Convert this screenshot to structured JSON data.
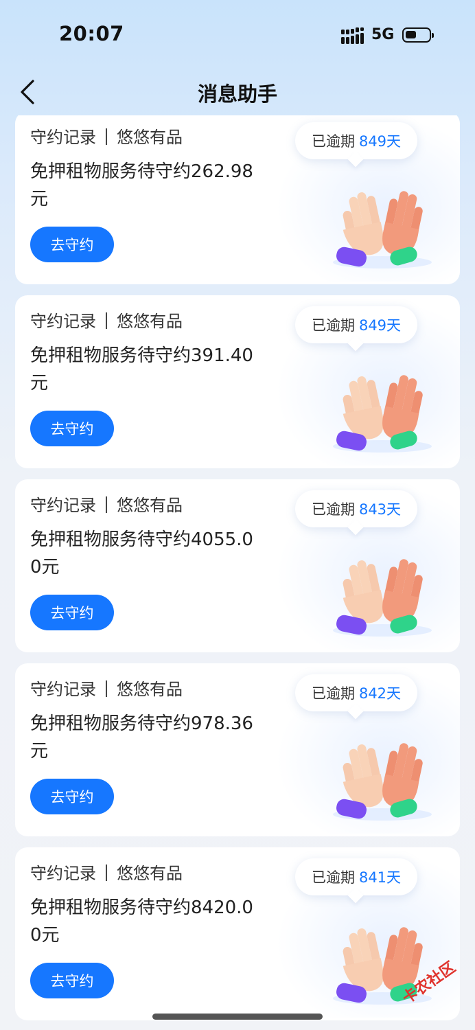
{
  "status_bar": {
    "time": "20:07",
    "network": "5G"
  },
  "nav": {
    "title": "消息助手"
  },
  "cards": [
    {
      "category": "守约记录",
      "merchant": "悠悠有品",
      "message": "免押租物服务待守约262.98元",
      "overdue_label": "已逾期",
      "overdue_days": "849天",
      "action": "去守约"
    },
    {
      "category": "守约记录",
      "merchant": "悠悠有品",
      "message": "免押租物服务待守约391.40元",
      "overdue_label": "已逾期",
      "overdue_days": "849天",
      "action": "去守约"
    },
    {
      "category": "守约记录",
      "merchant": "悠悠有品",
      "message": "免押租物服务待守约4055.00元",
      "overdue_label": "已逾期",
      "overdue_days": "843天",
      "action": "去守约"
    },
    {
      "category": "守约记录",
      "merchant": "悠悠有品",
      "message": "免押租物服务待守约978.36元",
      "overdue_label": "已逾期",
      "overdue_days": "842天",
      "action": "去守约"
    },
    {
      "category": "守约记录",
      "merchant": "悠悠有品",
      "message": "免押租物服务待守约8420.00元",
      "overdue_label": "已逾期",
      "overdue_days": "841天",
      "action": "去守约"
    }
  ],
  "watermark": "卡农社区",
  "colors": {
    "accent": "#1677ff",
    "card_bg": "#ffffff",
    "page_bg_top": "#c9e3fb"
  }
}
